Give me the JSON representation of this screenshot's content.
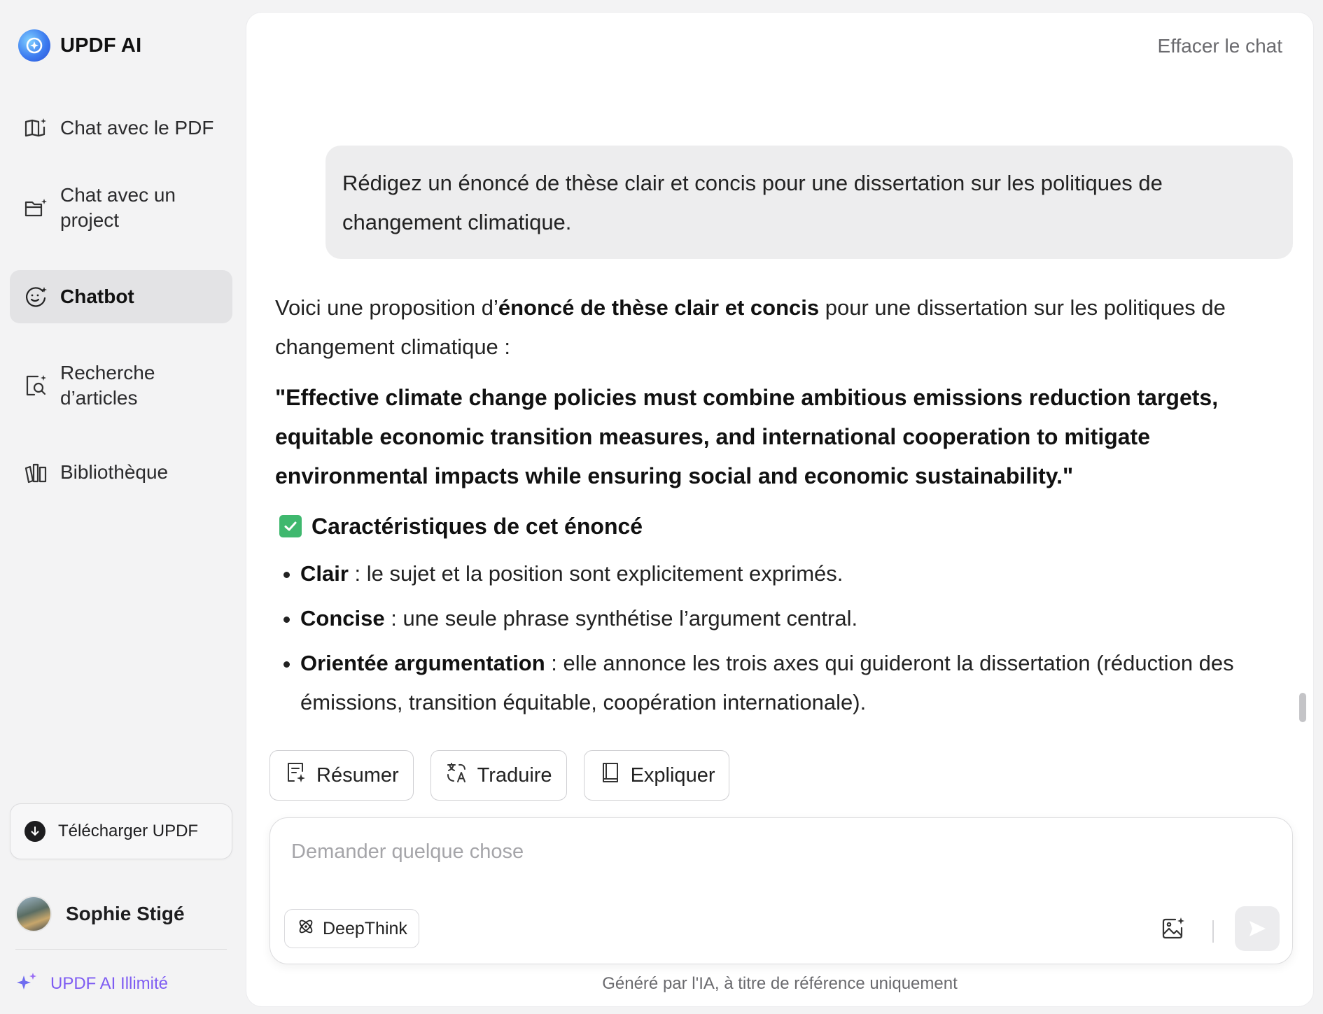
{
  "app": {
    "name": "UPDF AI",
    "accent_color": "#7e5cf2"
  },
  "sidebar": {
    "items": [
      {
        "label": "Chat avec le PDF",
        "icon": "book-sparkle-icon"
      },
      {
        "label": "Chat avec un project",
        "icon": "folder-sparkle-icon"
      },
      {
        "label": "Chatbot",
        "icon": "chatbot-face-icon",
        "active": true
      },
      {
        "label": "Recherche d’articles",
        "icon": "document-search-icon"
      },
      {
        "label": "Bibliothèque",
        "icon": "library-books-icon"
      }
    ],
    "download_label": "Télécharger UPDF",
    "user_name": "Sophie Stigé",
    "premium_label": "UPDF AI Illimité"
  },
  "header": {
    "clear_chat_label": "Effacer le chat"
  },
  "conversation": {
    "user_message": "Rédigez un énoncé de thèse clair et concis pour une dissertation sur les politiques de changement climatique.",
    "answer": {
      "intro_before": "Voici une proposition d’",
      "intro_bold": "énoncé de thèse clair et concis",
      "intro_after": " pour une dissertation sur les politiques de changement climatique :",
      "thesis": "\"Effective climate change policies must combine ambitious emissions reduction targets, equitable economic transition measures, and international cooperation to mitigate environmental impacts while ensuring social and economic sustainability.\"",
      "features_title": "Caractéristiques de cet énoncé",
      "features": [
        {
          "term": "Clair",
          "text": " : le sujet et la position sont explicitement exprimés."
        },
        {
          "term": "Concise",
          "text": " : une seule phrase synthétise l’argument central."
        },
        {
          "term": "Orientée argumentation",
          "text": " : elle annonce les trois axes qui guideront la dissertation (réduction des émissions, transition équitable, coopération internationale)."
        }
      ]
    }
  },
  "quick_actions": [
    {
      "label": "Résumer",
      "icon": "summarize-icon"
    },
    {
      "label": "Traduire",
      "icon": "translate-icon"
    },
    {
      "label": "Expliquer",
      "icon": "explain-book-icon"
    }
  ],
  "composer": {
    "placeholder": "Demander quelque chose",
    "value": "",
    "deepthink_label": "DeepThink"
  },
  "footer": {
    "disclaimer": "Généré par l'IA, à titre de référence uniquement"
  }
}
